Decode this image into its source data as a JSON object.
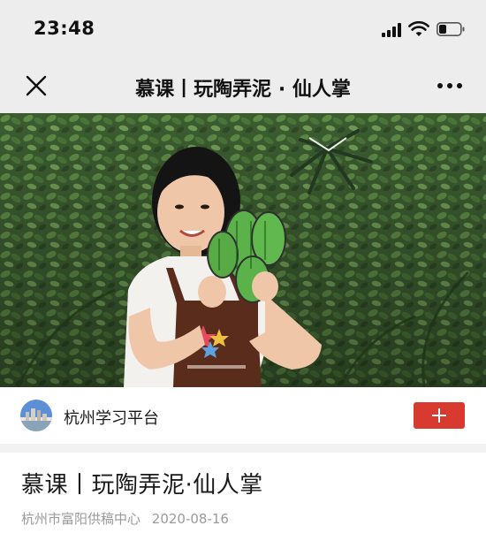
{
  "status_bar": {
    "time": "23:48",
    "icons": [
      "signal-icon",
      "wifi-icon",
      "battery-icon"
    ]
  },
  "nav": {
    "title": "慕课丨玩陶弄泥 · 仙人掌",
    "close_icon": "close-icon",
    "more_icon": "more-dots-icon"
  },
  "video": {
    "description_icon": "video-thumbnail"
  },
  "account": {
    "name": "杭州学习平台",
    "follow_icon": "plus-icon",
    "follow_color": "#d93a30"
  },
  "article": {
    "title": "慕课丨玩陶弄泥·仙人掌",
    "source": "杭州市富阳供稿中心",
    "date": "2020-08-16"
  },
  "colors": {
    "bar_background": "#ededed",
    "meta_text": "#9a9a9a"
  }
}
